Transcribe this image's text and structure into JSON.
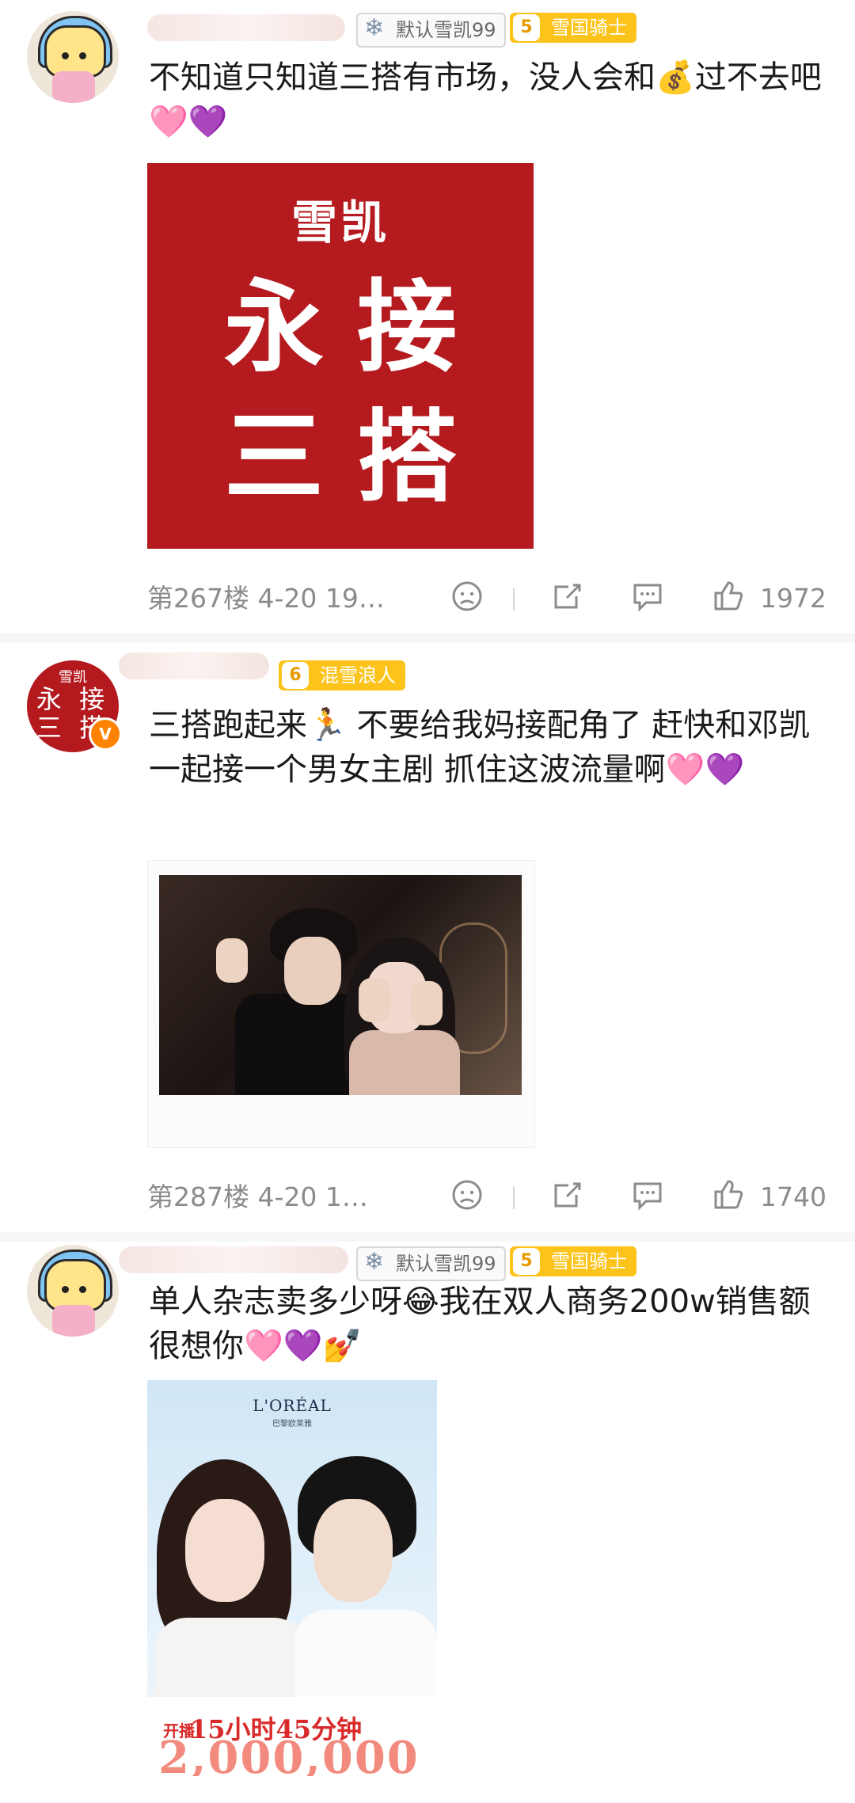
{
  "comments": [
    {
      "badges": {
        "fan": "默认雪凯99",
        "level": "5",
        "title": "雪国骑士"
      },
      "text": "不知道只知道三搭有市场，没人会和💰过不去吧🩷💜",
      "image": {
        "small": "雪凯",
        "line1": "永接",
        "line2": "三搭"
      },
      "meta": {
        "floor_time": "第267楼 4-20 19…",
        "likes": "1972"
      }
    },
    {
      "avatar_text": {
        "top": "雪凯",
        "mid": "永 接",
        "bot": "三 搭"
      },
      "verified": "V",
      "badges": {
        "level": "6",
        "title": "混雪浪人"
      },
      "text": "三搭跑起来🏃 不要给我妈接配角了 赶快和邓凯一起接一个男女主剧 抓住这波流量啊🩷💜",
      "meta": {
        "floor_time": "第287楼 4-20 1…",
        "likes": "1740"
      }
    },
    {
      "badges": {
        "fan": "默认雪凯99",
        "level": "5",
        "title": "雪国骑士"
      },
      "text": "单人杂志卖多少呀😂我在双人商务200w销售额很想你🩷💜💅",
      "ad": {
        "brand": "L'ORÉAL",
        "sub": "巴黎欧莱雅",
        "kaibo": "开播",
        "duration": "15小时45分钟",
        "number": "2,000,000"
      }
    }
  ]
}
